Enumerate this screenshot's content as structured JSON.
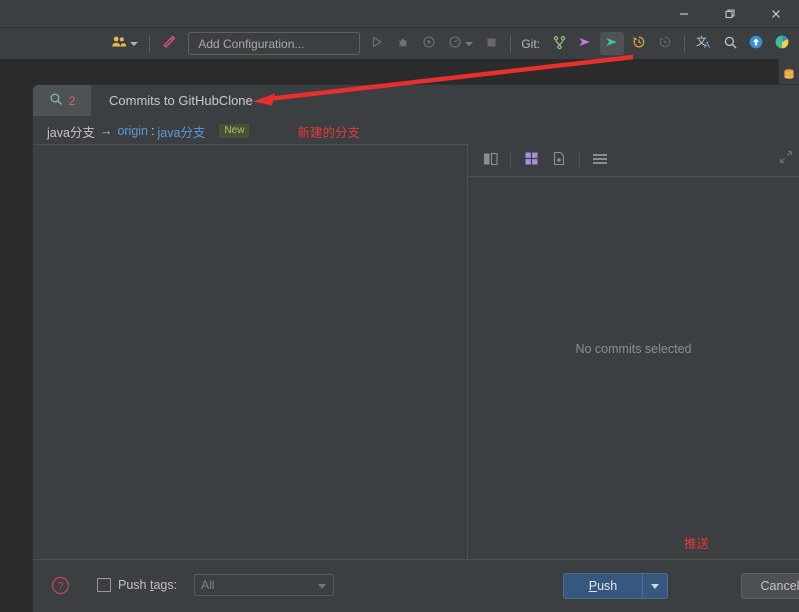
{
  "window": {
    "controls": [
      {
        "name": "minimize",
        "glyph": "minimize-icon"
      },
      {
        "name": "restore",
        "glyph": "restore-icon"
      },
      {
        "name": "close",
        "glyph": "close-icon"
      }
    ]
  },
  "toolbar": {
    "user_icon": "users-icon",
    "build_icon": "hammer-icon",
    "run_config_label": "Add Configuration...",
    "run_icon": "run-icon",
    "debug_icon": "debug-icon",
    "coverage_icon": "run-with-coverage-icon",
    "profile_icon": "profiler-icon",
    "stop_icon": "stop-icon",
    "git_label": "Git:",
    "branch_icon": "branch-icon",
    "update_icon": "update-project-icon",
    "push_icon": "push-commits-icon",
    "history_icon": "rollback-history-icon",
    "revert_icon": "revert-icon",
    "translate_icon": "translate-icon",
    "search_icon": "search-everywhere-icon",
    "upload_icon": "upload-icon",
    "ide_icon": "ide-logo-icon"
  },
  "rail": {
    "database_icon": "database-icon",
    "secondary_icon": "panel-icon"
  },
  "dialog": {
    "search_count": "2",
    "search_icon": "search-icon",
    "title": "Commits to GitHubClone",
    "branch": {
      "local": "java分支",
      "arrow": "→",
      "remote_name": "origin",
      "colon": ":",
      "remote_branch": "java分支",
      "badge": "New"
    },
    "annotation_branch": "新建的分支",
    "annotation_push": "推送",
    "right_toolbar": {
      "side_by_side_icon": "side-by-side-viewer-icon",
      "grid_icon": "grid-view-icon",
      "file_icon": "file-diff-icon",
      "list_icon": "list-view-icon",
      "expand_icon": "expand-collapse-icon"
    },
    "empty_state": "No commits selected",
    "footer": {
      "help_icon": "help-icon",
      "push_tags_label_pre": "Push ",
      "push_tags_label_u": "t",
      "push_tags_label_post": "ags:",
      "tags_value": "All",
      "push_label_pre": "",
      "push_label_u": "P",
      "push_label_post": "ush",
      "cancel_label": "Cancel"
    }
  },
  "annotation": {
    "arrow_color": "#e82f2f"
  },
  "colors": {
    "accent_blue": "#365880",
    "panel_bg": "#3c3f41",
    "editor_bg": "#2b2b2b",
    "link": "#5b9bd5",
    "badge_green": "#a8c36a",
    "annotation_red": "#e03a3a"
  }
}
